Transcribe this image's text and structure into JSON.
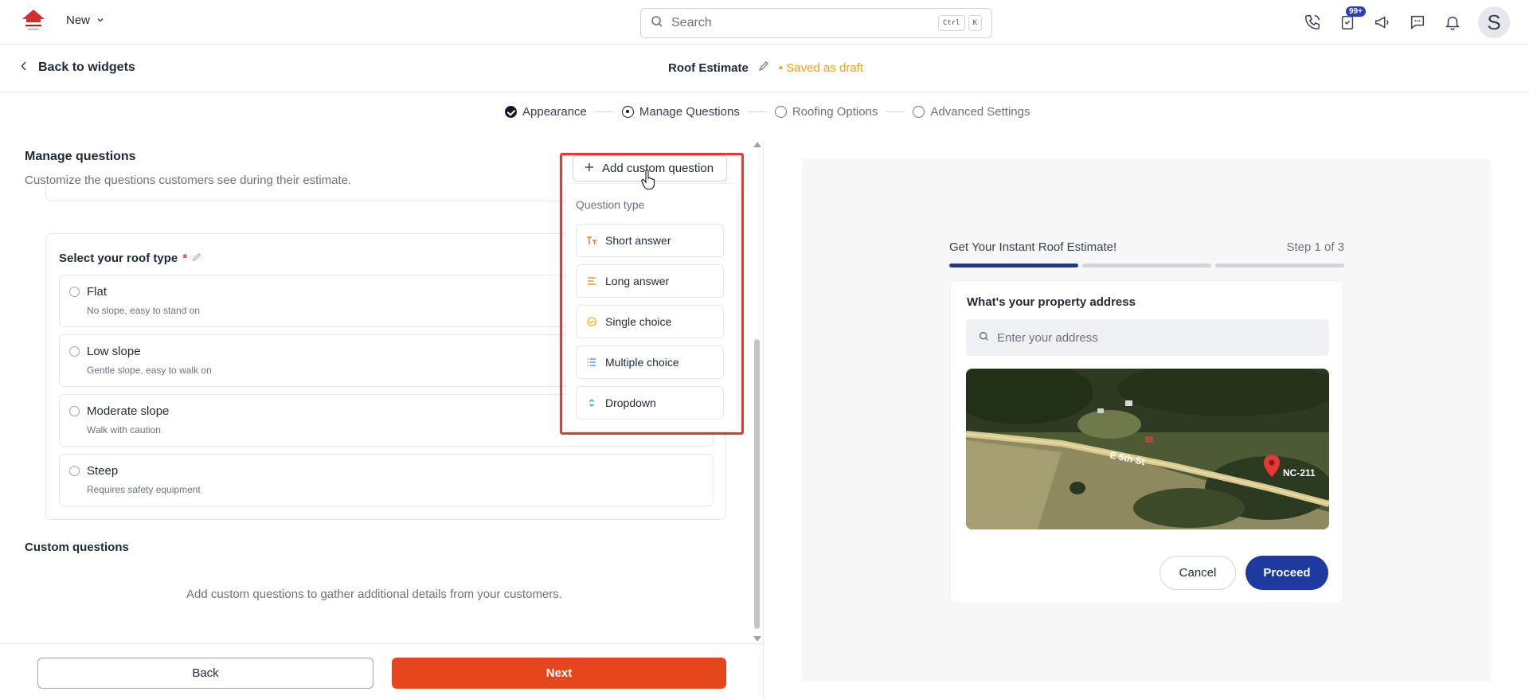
{
  "colors": {
    "accent_orange": "#e5471c",
    "saved_amber": "#f59e0b",
    "highlight_red": "#e53935",
    "preview_blue": "#1e3a9e",
    "badge_blue": "#2b3fb8"
  },
  "topbar": {
    "new_label": "New",
    "search_placeholder": "Search",
    "shortcut_key1": "Ctrl",
    "shortcut_key2": "K",
    "tasks_badge": "99+",
    "avatar_initial": "S"
  },
  "subbar": {
    "back_label": "Back to widgets",
    "widget_title": "Roof Estimate",
    "status": "• Saved as draft"
  },
  "steps": [
    {
      "label": "Appearance",
      "state": "done"
    },
    {
      "label": "Manage Questions",
      "state": "active"
    },
    {
      "label": "Roofing Options",
      "state": "pending"
    },
    {
      "label": "Advanced Settings",
      "state": "pending"
    }
  ],
  "manage": {
    "title": "Manage questions",
    "subtitle": "Customize the questions customers see during their estimate.",
    "question": {
      "label": "Select your roof type",
      "required_mark": "*",
      "options": [
        {
          "name": "Flat",
          "desc": "No slope, easy to stand on"
        },
        {
          "name": "Low slope",
          "desc": "Gentle slope, easy to walk on"
        },
        {
          "name": "Moderate slope",
          "desc": "Walk with caution"
        },
        {
          "name": "Steep",
          "desc": "Requires safety equipment"
        }
      ]
    },
    "custom_title": "Custom questions",
    "custom_empty": "Add custom questions to gather additional details from your customers."
  },
  "add_menu": {
    "button_label": "Add custom question",
    "section_label": "Question type",
    "items": [
      {
        "label": "Short answer",
        "icon": "text-format-icon"
      },
      {
        "label": "Long answer",
        "icon": "lines-icon"
      },
      {
        "label": "Single choice",
        "icon": "check-circle-icon"
      },
      {
        "label": "Multiple choice",
        "icon": "list-check-icon"
      },
      {
        "label": "Dropdown",
        "icon": "chevron-updown-icon"
      }
    ]
  },
  "footer": {
    "back_label": "Back",
    "next_label": "Next"
  },
  "preview": {
    "heading": "Get Your Instant Roof Estimate!",
    "step_counter": "Step 1 of 3",
    "progress_steps_total": 3,
    "progress_steps_done": 1,
    "question": "What's your property address",
    "address_placeholder": "Enter your address",
    "map_street": "E 5th St",
    "map_road_label": "NC-211",
    "cancel_label": "Cancel",
    "proceed_label": "Proceed"
  }
}
